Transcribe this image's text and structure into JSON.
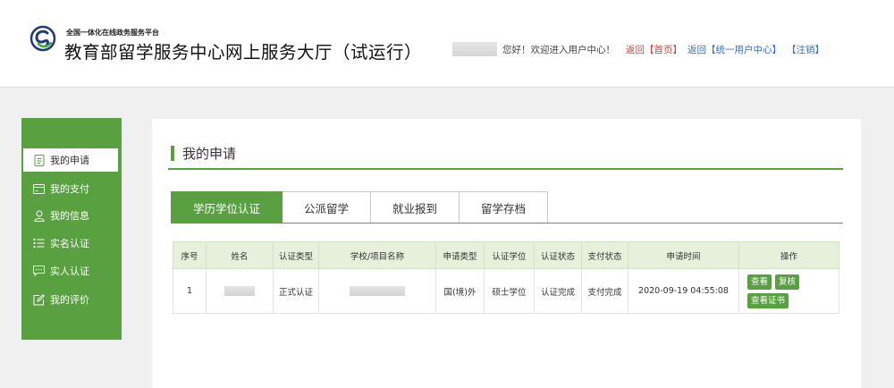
{
  "header": {
    "platform": "全国一体化在线政务服务平台",
    "title": "教育部留学服务中心网上服务大厅（试运行）",
    "welcome": "您好！欢迎进入用户中心！",
    "links": {
      "home": "返回【首页】",
      "unified": "返回【统一用户中心】",
      "logout": "【注销】"
    }
  },
  "sidebar": {
    "items": [
      {
        "label": "我的申请",
        "icon": "document-icon"
      },
      {
        "label": "我的支付",
        "icon": "card-icon"
      },
      {
        "label": "我的信息",
        "icon": "user-icon"
      },
      {
        "label": "实名认证",
        "icon": "list-icon"
      },
      {
        "label": "实人认证",
        "icon": "chat-icon"
      },
      {
        "label": "我的评价",
        "icon": "edit-icon"
      }
    ]
  },
  "main": {
    "section_title": "我的申请",
    "tabs": [
      "学历学位认证",
      "公派留学",
      "就业报到",
      "留学存档"
    ],
    "table": {
      "columns": [
        "序号",
        "姓名",
        "认证类型",
        "学校/项目名称",
        "申请类型",
        "认证学位",
        "认证状态",
        "支付状态",
        "申请时间",
        "操作"
      ],
      "rows": [
        {
          "index": "1",
          "cert_type": "正式认证",
          "apply_type": "国(境)外",
          "degree": "硕士学位",
          "cert_status": "认证完成",
          "pay_status": "支付完成",
          "time": "2020-09-19 04:55:08",
          "actions": [
            "查看",
            "复核",
            "查看证书"
          ]
        }
      ]
    }
  },
  "colors": {
    "brand_green": "#58a040",
    "link_red": "#d9413a",
    "link_blue": "#3a6fd1",
    "status_green": "#4fa53a"
  }
}
